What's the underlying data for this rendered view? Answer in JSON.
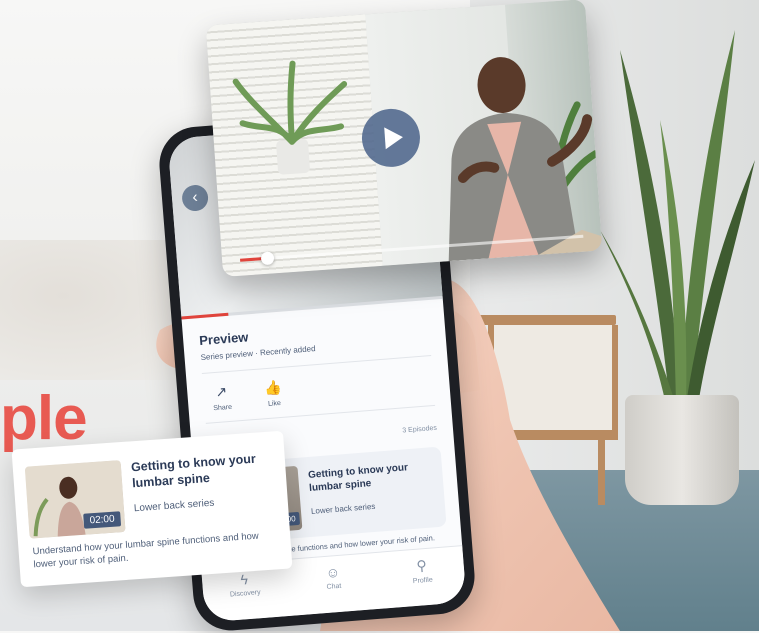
{
  "headline": {
    "fragment": "ple"
  },
  "video_player": {
    "play_icon": "play-icon",
    "progress_fraction": 0.07,
    "accent_color": "#e0443c",
    "play_button_color": "#4e668c"
  },
  "phone": {
    "back_icon": "chevron-left-icon",
    "preview": {
      "title": "Preview",
      "subtitle": "Series preview · Recently added"
    },
    "actions": [
      {
        "label": "Share",
        "icon": "share-icon"
      },
      {
        "label": "Like",
        "icon": "thumbs-up-icon"
      }
    ],
    "episodes": {
      "title": "les",
      "count": "3 Episodes",
      "card": {
        "title": "Getting to know your lumbar spine",
        "series": "Lower back series",
        "duration": "02:00",
        "description": "d how your lumbar spine functions and how lower your risk of pain."
      }
    },
    "tabs": [
      {
        "label": "Discovery",
        "icon": "lightning-icon"
      },
      {
        "label": "Chat",
        "icon": "chat-icon"
      },
      {
        "label": "Profile",
        "icon": "person-icon"
      }
    ]
  },
  "episode_card": {
    "title": "Getting to know your lumbar spine",
    "series": "Lower back series",
    "duration": "02:00",
    "description": "Understand how your lumbar spine functions and how lower your risk of pain."
  }
}
